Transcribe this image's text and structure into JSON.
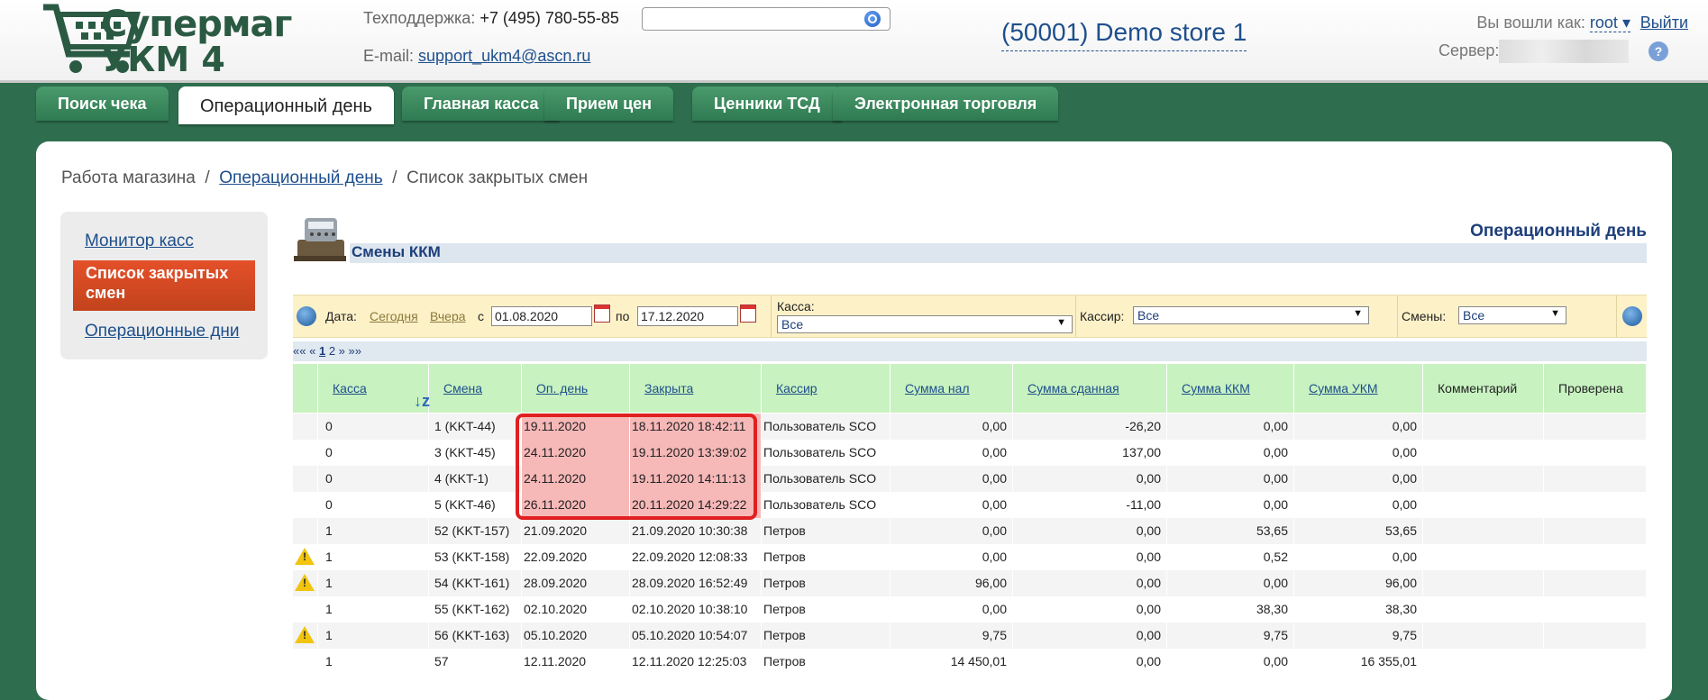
{
  "header": {
    "logo_line1": "Супермаг",
    "logo_line2": "УКМ 4",
    "support_label": "Техподдержка:",
    "support_phone": "+7 (495) 780-55-85",
    "email_label": "E-mail:",
    "email": "support_ukm4@ascn.ru",
    "search_placeholder": "",
    "store": "(50001) Demo store 1",
    "logged_in_label": "Вы вошли как:",
    "user": "root",
    "logout": "Выйти",
    "server_label": "Сервер:"
  },
  "tabs": [
    {
      "label": "Поиск чека",
      "active": false
    },
    {
      "label": "Операционный день",
      "active": true
    },
    {
      "label": "Главная касса",
      "active": false
    },
    {
      "label": "Прием цен",
      "active": false
    },
    {
      "label": "Ценники ТСД",
      "active": false
    },
    {
      "label": "Электронная торговля",
      "active": false
    }
  ],
  "breadcrumb": {
    "root": "Работа магазина",
    "link": "Операционный день",
    "current": "Список закрытых смен"
  },
  "sidebar": {
    "items": [
      {
        "label": "Монитор касс"
      },
      {
        "label": "Список закрытых смен"
      },
      {
        "label": "Операционные дни"
      }
    ]
  },
  "section": {
    "title": "Операционный день",
    "subtitle": "Смены ККМ"
  },
  "filter": {
    "date_label": "Дата:",
    "today": "Сегодня",
    "yesterday": "Вчера",
    "from_label": "с",
    "from_value": "01.08.2020",
    "to_label": "по",
    "to_value": "17.12.2020",
    "kassa_label": "Касса:",
    "kassa_value": "Все",
    "cashier_label": "Кассир:",
    "cashier_value": "Все",
    "shifts_label": "Смены:",
    "shifts_value": "Все"
  },
  "pager": {
    "first": "««",
    "prev": "«",
    "page1": "1",
    "page2": "2",
    "next": "»",
    "last": "»»"
  },
  "table": {
    "headers": [
      "Касса",
      "Смена",
      "Оп. день",
      "Закрыта",
      "Кассир",
      "Сумма нал",
      "Сумма сданная",
      "Сумма ККМ",
      "Сумма УКМ",
      "Комментарий",
      "Проверена"
    ],
    "rows": [
      {
        "warn": false,
        "kassa": "0",
        "smena": "1 (KKT-44)",
        "opday": "19.11.2020",
        "closed": "18.11.2020 18:42:11",
        "cashier": "Пользователь SCO",
        "cash": "0,00",
        "handed": "-26,20",
        "kkm": "0,00",
        "ukm": "0,00",
        "hl": true
      },
      {
        "warn": false,
        "kassa": "0",
        "smena": "3 (KKT-45)",
        "opday": "24.11.2020",
        "closed": "19.11.2020 13:39:02",
        "cashier": "Пользователь SCO",
        "cash": "0,00",
        "handed": "137,00",
        "kkm": "0,00",
        "ukm": "0,00",
        "hl": true
      },
      {
        "warn": false,
        "kassa": "0",
        "smena": "4 (KKT-1)",
        "opday": "24.11.2020",
        "closed": "19.11.2020 14:11:13",
        "cashier": "Пользователь SCO",
        "cash": "0,00",
        "handed": "0,00",
        "kkm": "0,00",
        "ukm": "0,00",
        "hl": true
      },
      {
        "warn": false,
        "kassa": "0",
        "smena": "5 (KKT-46)",
        "opday": "26.11.2020",
        "closed": "20.11.2020 14:29:22",
        "cashier": "Пользователь SCO",
        "cash": "0,00",
        "handed": "-11,00",
        "kkm": "0,00",
        "ukm": "0,00",
        "hl": true
      },
      {
        "warn": false,
        "kassa": "1",
        "smena": "52 (KKT-157)",
        "opday": "21.09.2020",
        "closed": "21.09.2020 10:30:38",
        "cashier": "Петров",
        "cash": "0,00",
        "handed": "0,00",
        "kkm": "53,65",
        "ukm": "53,65",
        "hl": false
      },
      {
        "warn": true,
        "kassa": "1",
        "smena": "53 (KKT-158)",
        "opday": "22.09.2020",
        "closed": "22.09.2020 12:08:33",
        "cashier": "Петров",
        "cash": "0,00",
        "handed": "0,00",
        "kkm": "0,52",
        "ukm": "0,00",
        "hl": false
      },
      {
        "warn": true,
        "kassa": "1",
        "smena": "54 (KKT-161)",
        "opday": "28.09.2020",
        "closed": "28.09.2020 16:52:49",
        "cashier": "Петров",
        "cash": "96,00",
        "handed": "0,00",
        "kkm": "0,00",
        "ukm": "96,00",
        "hl": false
      },
      {
        "warn": false,
        "kassa": "1",
        "smena": "55 (KKT-162)",
        "opday": "02.10.2020",
        "closed": "02.10.2020 10:38:10",
        "cashier": "Петров",
        "cash": "0,00",
        "handed": "0,00",
        "kkm": "38,30",
        "ukm": "38,30",
        "hl": false
      },
      {
        "warn": true,
        "kassa": "1",
        "smena": "56 (KKT-163)",
        "opday": "05.10.2020",
        "closed": "05.10.2020 10:54:07",
        "cashier": "Петров",
        "cash": "9,75",
        "handed": "0,00",
        "kkm": "9,75",
        "ukm": "9,75",
        "hl": false
      },
      {
        "warn": false,
        "kassa": "1",
        "smena": "57",
        "opday": "12.11.2020",
        "closed": "12.11.2020 12:25:03",
        "cashier": "Петров",
        "cash": "14 450,01",
        "handed": "0,00",
        "kkm": "0,00",
        "ukm": "16 355,01",
        "hl": false
      }
    ]
  },
  "colors": {
    "brand_green": "#2e6e4e",
    "link_blue": "#1e4f8c",
    "header_green": "#c8f2c0",
    "filter_yellow": "#fdf1c8",
    "highlight_red": "#e02020",
    "active_orange": "#d94a22"
  }
}
